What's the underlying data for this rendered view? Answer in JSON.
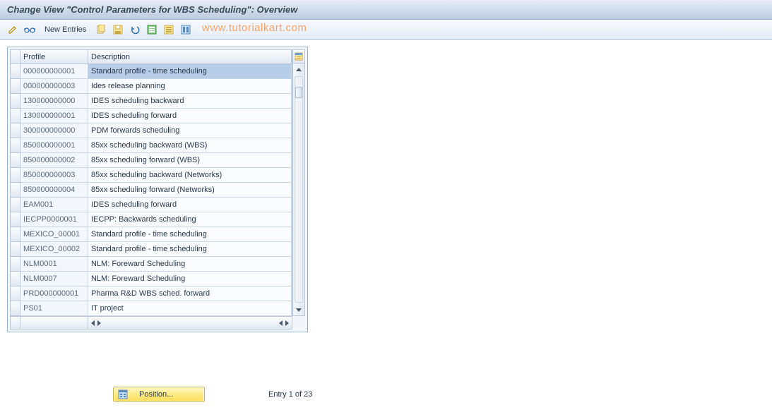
{
  "title": "Change View \"Control Parameters for WBS Scheduling\": Overview",
  "toolbar": {
    "new_entries": "New Entries"
  },
  "watermark": "www.tutorialkart.com",
  "table": {
    "col_profile": "Profile",
    "col_description": "Description",
    "rows": [
      {
        "profile": "000000000001",
        "desc": "Standard profile - time scheduling",
        "selected": true
      },
      {
        "profile": "000000000003",
        "desc": "Ides release planning"
      },
      {
        "profile": "130000000000",
        "desc": "IDES scheduling backward"
      },
      {
        "profile": "130000000001",
        "desc": "IDES scheduling forward"
      },
      {
        "profile": "300000000000",
        "desc": "PDM  forwards scheduling"
      },
      {
        "profile": "850000000001",
        "desc": "85xx scheduling backward (WBS)"
      },
      {
        "profile": "850000000002",
        "desc": "85xx scheduling forward (WBS)"
      },
      {
        "profile": "850000000003",
        "desc": "85xx scheduling backward (Networks)"
      },
      {
        "profile": "850000000004",
        "desc": "85xx scheduling forward (Networks)"
      },
      {
        "profile": "EAM001",
        "desc": "IDES scheduling forward"
      },
      {
        "profile": "IECPP0000001",
        "desc": "IECPP: Backwards scheduling"
      },
      {
        "profile": "MEXICO_00001",
        "desc": "Standard profile - time scheduling"
      },
      {
        "profile": "MEXICO_00002",
        "desc": "Standard profile - time scheduling"
      },
      {
        "profile": "NLM0001",
        "desc": "NLM: Foreward Scheduling"
      },
      {
        "profile": "NLM0007",
        "desc": "NLM: Foreward Scheduling"
      },
      {
        "profile": "PRD000000001",
        "desc": "Pharma R&D WBS sched. forward"
      },
      {
        "profile": "PS01",
        "desc": "IT project"
      }
    ]
  },
  "footer": {
    "position_btn": "Position...",
    "entry_status": "Entry 1 of 23"
  }
}
